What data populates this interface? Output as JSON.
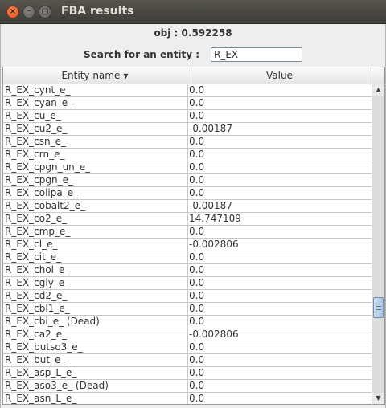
{
  "window": {
    "title": "FBA results",
    "close_glyph": "×",
    "minimize_glyph": "–",
    "maximize_glyph": "▢"
  },
  "header": {
    "objective": "obj : 0.592258",
    "search_label": "Search for an entity :",
    "search_value": "R_EX"
  },
  "table": {
    "columns": {
      "entity": "Entity name",
      "value": "Value"
    },
    "sort_indicator": "▼",
    "rows": [
      {
        "entity": "R_EX_cynt_e_",
        "value": "0.0"
      },
      {
        "entity": "R_EX_cyan_e_",
        "value": "0.0"
      },
      {
        "entity": "R_EX_cu_e_",
        "value": "0.0"
      },
      {
        "entity": "R_EX_cu2_e_",
        "value": "-0.00187"
      },
      {
        "entity": "R_EX_csn_e_",
        "value": "0.0"
      },
      {
        "entity": "R_EX_crn_e_",
        "value": "0.0"
      },
      {
        "entity": "R_EX_cpgn_un_e_",
        "value": "0.0"
      },
      {
        "entity": "R_EX_cpgn_e_",
        "value": "0.0"
      },
      {
        "entity": "R_EX_colipa_e_",
        "value": "0.0"
      },
      {
        "entity": "R_EX_cobalt2_e_",
        "value": "-0.00187"
      },
      {
        "entity": "R_EX_co2_e_",
        "value": "14.747109"
      },
      {
        "entity": "R_EX_cmp_e_",
        "value": "0.0"
      },
      {
        "entity": "R_EX_cl_e_",
        "value": "-0.002806"
      },
      {
        "entity": "R_EX_cit_e_",
        "value": "0.0"
      },
      {
        "entity": "R_EX_chol_e_",
        "value": "0.0"
      },
      {
        "entity": "R_EX_cgly_e_",
        "value": "0.0"
      },
      {
        "entity": "R_EX_cd2_e_",
        "value": "0.0"
      },
      {
        "entity": "R_EX_cbl1_e_",
        "value": "0.0"
      },
      {
        "entity": "R_EX_cbi_e_ (Dead)",
        "value": "0.0"
      },
      {
        "entity": "R_EX_ca2_e_",
        "value": "-0.002806"
      },
      {
        "entity": "R_EX_butso3_e_",
        "value": "0.0"
      },
      {
        "entity": "R_EX_but_e_",
        "value": "0.0"
      },
      {
        "entity": "R_EX_asp_L_e_",
        "value": "0.0"
      },
      {
        "entity": "R_EX_aso3_e_ (Dead)",
        "value": "0.0"
      },
      {
        "entity": "R_EX_asn_L_e_",
        "value": "0.0"
      }
    ]
  },
  "scrollbar": {
    "up_glyph": "▲",
    "down_glyph": "▼",
    "thumb_fraction": 0.73
  }
}
